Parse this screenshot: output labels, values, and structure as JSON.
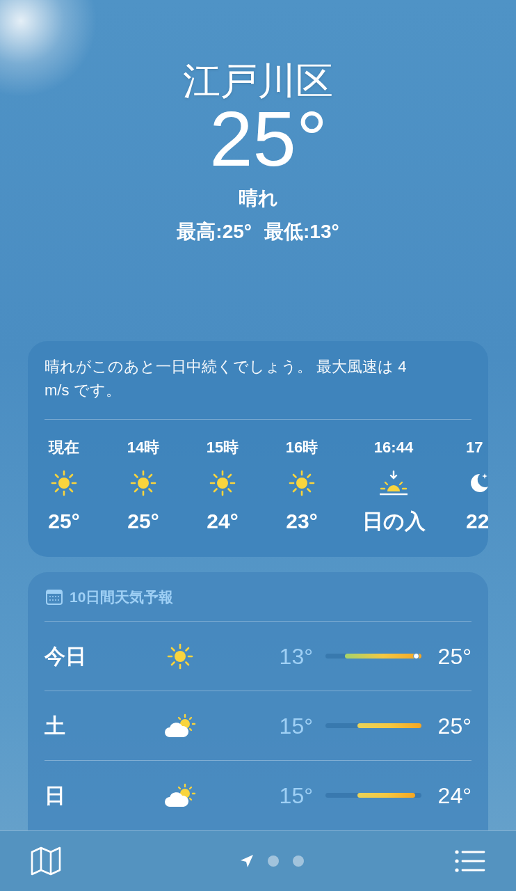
{
  "location": {
    "city": "江戸川区",
    "temperature": "25°",
    "condition": "晴れ",
    "high": "最高:25°",
    "low": "最低:13°"
  },
  "hourly_card": {
    "summary": "晴れがこのあと一日中続くでしょう。 最大風速は 4 m/s です。",
    "hours": [
      {
        "time": "現在",
        "kind": "sun",
        "value": "25°"
      },
      {
        "time": "14時",
        "kind": "sun",
        "value": "25°"
      },
      {
        "time": "15時",
        "kind": "sun",
        "value": "24°"
      },
      {
        "time": "16時",
        "kind": "sun",
        "value": "23°"
      },
      {
        "time": "16:44",
        "kind": "sunset",
        "value": "日の入"
      },
      {
        "time": "17",
        "kind": "moon",
        "value": "22"
      }
    ]
  },
  "daily_card": {
    "title": "10日間天気予報",
    "days": [
      {
        "day": "今日",
        "kind": "sun",
        "low": "13°",
        "high": "25°",
        "now_marker": true
      },
      {
        "day": "土",
        "kind": "partly-cloudy",
        "low": "15°",
        "high": "25°",
        "now_marker": false
      },
      {
        "day": "日",
        "kind": "partly-cloudy",
        "low": "15°",
        "high": "24°",
        "now_marker": false
      }
    ]
  },
  "bottom_bar": {
    "pages": [
      {
        "kind": "location",
        "selected": true
      },
      {
        "kind": "dot",
        "selected": false
      },
      {
        "kind": "dot",
        "selected": false
      }
    ]
  }
}
